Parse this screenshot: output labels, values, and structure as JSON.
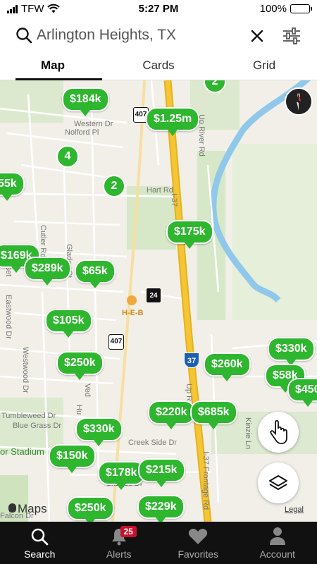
{
  "status": {
    "carrier": "TFW",
    "time": "5:27 PM",
    "battery": "100%"
  },
  "search": {
    "query": "Arlington Heights, TX"
  },
  "tabs": [
    {
      "label": "Map"
    },
    {
      "label": "Cards"
    },
    {
      "label": "Grid"
    }
  ],
  "map": {
    "pins": [
      "$184k",
      "$1.25m",
      "55k",
      "$175k",
      "$169k",
      "$289k",
      "$65k",
      "$105k",
      "$250k",
      "$330k",
      "$260k",
      "$58k",
      "$450",
      "$220k",
      "$685k",
      "$330k",
      "$150k",
      "$178k",
      "$215k",
      "$250k",
      "$229k"
    ],
    "clusters": [
      "2",
      "4",
      "2"
    ],
    "road_labels": [
      "Western Dr",
      "Nolford Pl",
      "Hart Rd",
      "Up River Rd",
      "I-37",
      "Cutler Rd",
      "Sunset",
      "Glades St",
      "Eastwood Dr",
      "Westwood Dr",
      "Ved",
      "Hu",
      "Tumbleweed Dr",
      "Blue Grass Dr",
      "Creek Side Dr",
      "Charles Dr",
      "Up R",
      "I-37 Frontage Rd",
      "Kinzie Ln",
      "Falcon Dr"
    ],
    "place_labels": [
      "H-E-B",
      "or Stadium"
    ],
    "shields": [
      "407",
      "24",
      "407",
      "37"
    ],
    "attribution": "Maps",
    "legal": "Legal",
    "pin_color": "#2fb62f",
    "highway_color": "#f4c534",
    "water_color": "#8fc8ea"
  },
  "tabbar": [
    {
      "label": "Search",
      "icon": "search-icon"
    },
    {
      "label": "Alerts",
      "icon": "bell-icon",
      "badge": "25"
    },
    {
      "label": "Favorites",
      "icon": "heart-icon"
    },
    {
      "label": "Account",
      "icon": "person-icon"
    }
  ]
}
